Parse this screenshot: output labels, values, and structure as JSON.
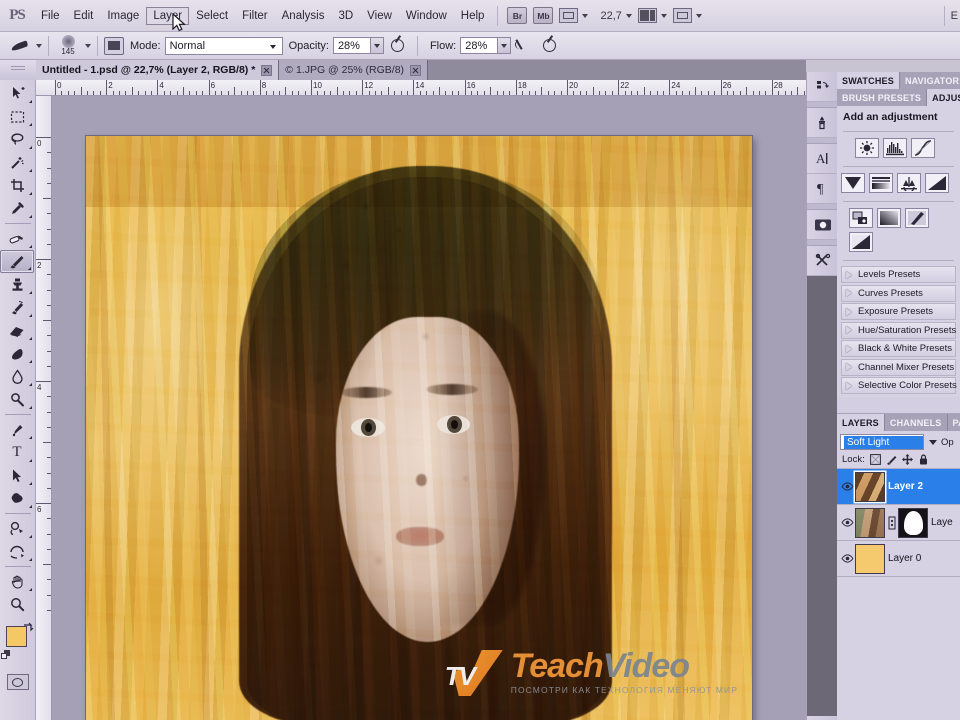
{
  "app": {
    "logo": "PS",
    "workspace_label": "E"
  },
  "menubar": {
    "items": [
      {
        "label": "File",
        "active": false
      },
      {
        "label": "Edit",
        "active": false
      },
      {
        "label": "Image",
        "active": false
      },
      {
        "label": "Layer",
        "active": true
      },
      {
        "label": "Select",
        "active": false
      },
      {
        "label": "Filter",
        "active": false
      },
      {
        "label": "Analysis",
        "active": false
      },
      {
        "label": "3D",
        "active": false
      },
      {
        "label": "View",
        "active": false
      },
      {
        "label": "Window",
        "active": false
      },
      {
        "label": "Help",
        "active": false
      }
    ],
    "bridge_button": "Br",
    "minibridge_button": "Mb",
    "zoom_level": "22,7"
  },
  "options_bar": {
    "brush_size": "145",
    "mode_label": "Mode:",
    "mode_value": "Normal",
    "opacity_label": "Opacity:",
    "opacity_value": "28%",
    "flow_label": "Flow:",
    "flow_value": "28%"
  },
  "document_tabs": [
    {
      "title": "Untitled - 1.psd @ 22,7% (Layer 2, RGB/8) *",
      "active": true
    },
    {
      "title": "© 1.JPG @ 25% (RGB/8)",
      "active": false
    }
  ],
  "rulers": {
    "horizontal_ticks": [
      "0",
      "2",
      "4",
      "6",
      "8",
      "10",
      "12",
      "14",
      "16",
      "18",
      "20",
      "22",
      "24",
      "26",
      "28"
    ],
    "vertical_ticks": [
      "0",
      "2",
      "4",
      "6"
    ]
  },
  "toolbar": {
    "tools": [
      {
        "name": "move-tool",
        "selected": false
      },
      {
        "name": "rectangular-marquee-tool",
        "selected": false
      },
      {
        "name": "lasso-tool",
        "selected": false
      },
      {
        "name": "magic-wand-tool",
        "selected": false
      },
      {
        "name": "crop-tool",
        "selected": false
      },
      {
        "name": "eyedropper-tool",
        "selected": false
      },
      {
        "name": "spot-healing-brush-tool",
        "selected": false
      },
      {
        "name": "brush-tool",
        "selected": true
      },
      {
        "name": "clone-stamp-tool",
        "selected": false
      },
      {
        "name": "history-brush-tool",
        "selected": false
      },
      {
        "name": "eraser-tool",
        "selected": false
      },
      {
        "name": "gradient-tool",
        "selected": false
      },
      {
        "name": "blur-tool",
        "selected": false
      },
      {
        "name": "dodge-tool",
        "selected": false
      },
      {
        "name": "pen-tool",
        "selected": false
      },
      {
        "name": "horizontal-type-tool",
        "selected": false,
        "glyph": "T"
      },
      {
        "name": "path-selection-tool",
        "selected": false
      },
      {
        "name": "custom-shape-tool",
        "selected": false
      },
      {
        "name": "rotate-3d-object-tool",
        "selected": false
      },
      {
        "name": "rotate-3d-camera-tool",
        "selected": false
      },
      {
        "name": "hand-tool",
        "selected": false
      },
      {
        "name": "zoom-tool",
        "selected": false
      }
    ],
    "foreground_color": "#f5c866",
    "background_color": "#ffffff"
  },
  "panels": {
    "top_tab_row_1": [
      {
        "label": "SWATCHES",
        "active": true
      },
      {
        "label": "NAVIGATOR",
        "active": false
      }
    ],
    "top_tab_row_2": [
      {
        "label": "BRUSH PRESETS",
        "active": false
      },
      {
        "label": "ADJUST",
        "active": true
      }
    ],
    "adjustments": {
      "heading": "Add an adjustment",
      "icons_row1": [
        "brightness-contrast-icon",
        "levels-icon",
        "curves-icon"
      ],
      "icons_row2": [
        "exposure-icon",
        "vibrance-icon",
        "hue-saturation-icon",
        "color-balance-icon"
      ],
      "icons_row3": [
        "black-white-icon",
        "photo-filter-icon",
        "channel-mixer-icon",
        "invert-icon"
      ],
      "presets": [
        "Levels Presets",
        "Curves Presets",
        "Exposure Presets",
        "Hue/Saturation Presets",
        "Black & White Presets",
        "Channel Mixer Presets",
        "Selective Color Presets"
      ]
    },
    "layers": {
      "tabs": [
        {
          "label": "LAYERS",
          "active": true
        },
        {
          "label": "CHANNELS",
          "active": false
        },
        {
          "label": "PA",
          "active": false
        }
      ],
      "blend_mode": "Soft Light",
      "opacity_label": "Op",
      "lock_label": "Lock:",
      "lock_icons": [
        "lock-transparent-pixels-icon",
        "lock-image-pixels-icon",
        "lock-position-icon",
        "lock-all-icon"
      ],
      "rows": [
        {
          "name": "Layer 2",
          "selected": true,
          "visible": true,
          "has_mask": false,
          "thumb": "a"
        },
        {
          "name": "Laye",
          "selected": false,
          "visible": true,
          "has_mask": true,
          "thumb": "b"
        },
        {
          "name": "Layer 0",
          "selected": false,
          "visible": true,
          "has_mask": false,
          "thumb": "c"
        }
      ]
    }
  },
  "icon_strip": [
    "history-panel-icon",
    "brush-panel-icon",
    "character-panel-icon",
    "paragraph-panel-icon",
    "masks-panel-icon",
    "tool-presets-panel-icon"
  ],
  "watermark": {
    "logo_letters": "TV",
    "title_part1": "Teach",
    "title_part2": "Video",
    "tagline": "ПОСМОТРИ КАК ТЕХНОЛОГИЯ МЕНЯЮТ МИР"
  },
  "colors": {
    "selection_blue": "#2a7fe8",
    "chrome": "#d3cee1",
    "canvas_gray": "#a6a0b6",
    "brand_orange": "#f3993a"
  }
}
